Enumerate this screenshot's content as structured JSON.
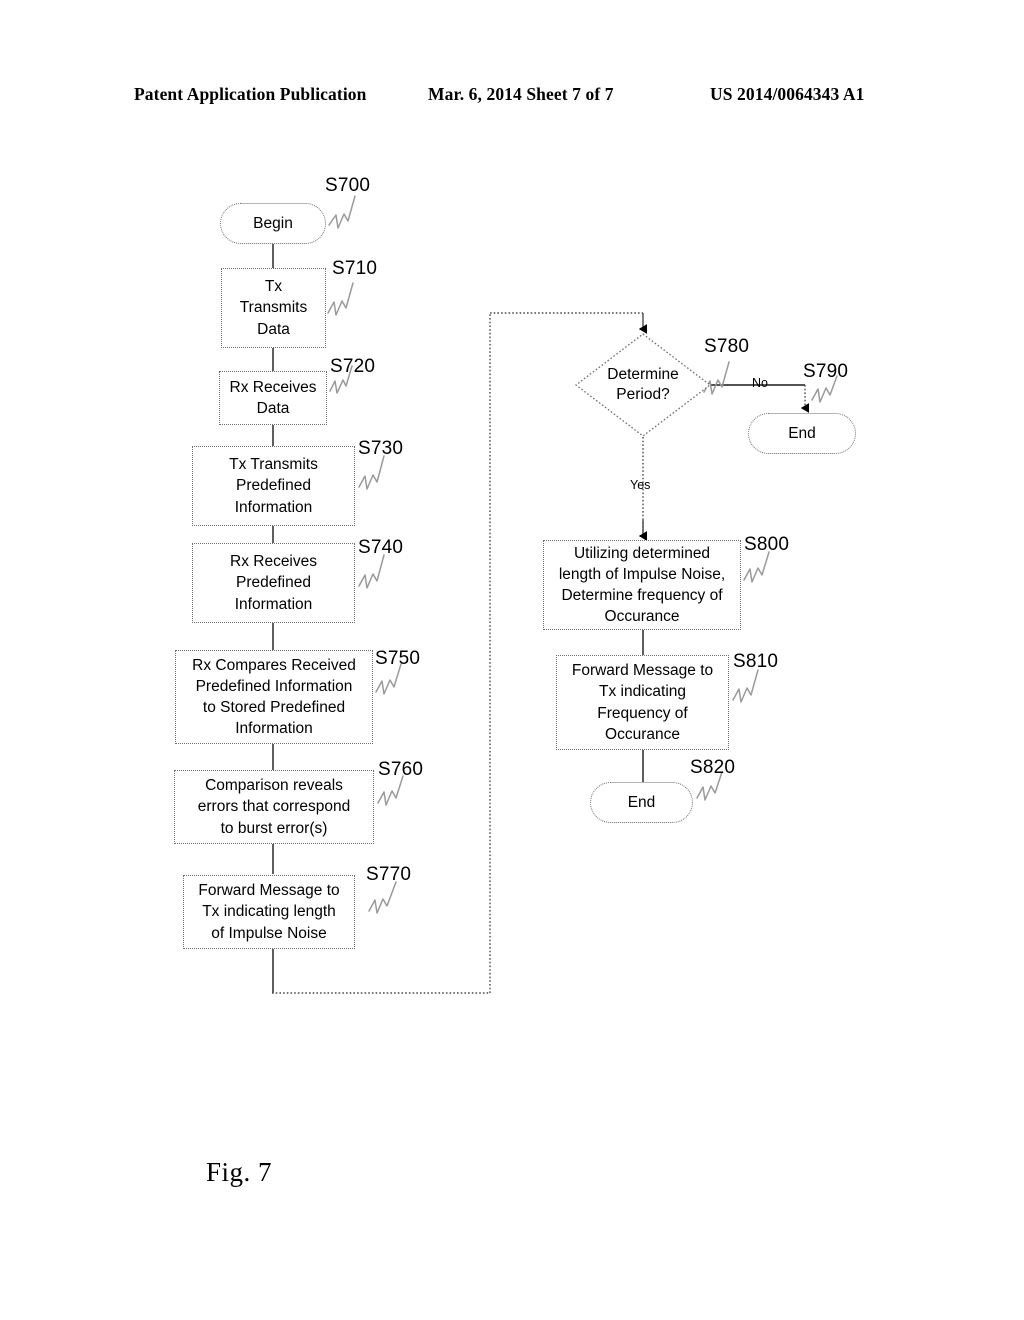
{
  "header": {
    "left": "Patent Application Publication",
    "middle": "Mar. 6, 2014  Sheet 7 of 7",
    "right": "US 2014/0064343 A1"
  },
  "figure": {
    "caption": "Fig. 7"
  },
  "flowchart": {
    "nodes": [
      {
        "id": "S700",
        "ref": "S700",
        "shape": "terminal",
        "text": "Begin"
      },
      {
        "id": "S710",
        "ref": "S710",
        "shape": "process",
        "text": "Tx\nTransmits\nData"
      },
      {
        "id": "S720",
        "ref": "S720",
        "shape": "process",
        "text": "Rx Receives\nData"
      },
      {
        "id": "S730",
        "ref": "S730",
        "shape": "process",
        "text": "Tx Transmits\nPredefined\nInformation"
      },
      {
        "id": "S740",
        "ref": "S740",
        "shape": "process",
        "text": "Rx Receives\nPredefined\nInformation"
      },
      {
        "id": "S750",
        "ref": "S750",
        "shape": "process",
        "text": "Rx Compares Received\nPredefined Information\nto Stored Predefined\nInformation"
      },
      {
        "id": "S760",
        "ref": "S760",
        "shape": "process",
        "text": "Comparison reveals\nerrors that correspond\nto burst error(s)"
      },
      {
        "id": "S770",
        "ref": "S770",
        "shape": "process",
        "text": "Forward Message to\nTx indicating length\nof Impulse Noise"
      },
      {
        "id": "S780",
        "ref": "S780",
        "shape": "decision",
        "text": "Determine\nPeriod?"
      },
      {
        "id": "S790",
        "ref": "S790",
        "shape": "terminal",
        "text": "End"
      },
      {
        "id": "S800",
        "ref": "S800",
        "shape": "process",
        "text": "Utilizing determined\nlength of Impulse Noise,\nDetermine frequency of\nOccurance"
      },
      {
        "id": "S810",
        "ref": "S810",
        "shape": "process",
        "text": "Forward Message to\nTx indicating\nFrequency of\nOccurance"
      },
      {
        "id": "S820",
        "ref": "S820",
        "shape": "terminal",
        "text": "End"
      }
    ],
    "branch_labels": {
      "no": "No",
      "yes": "Yes"
    }
  }
}
